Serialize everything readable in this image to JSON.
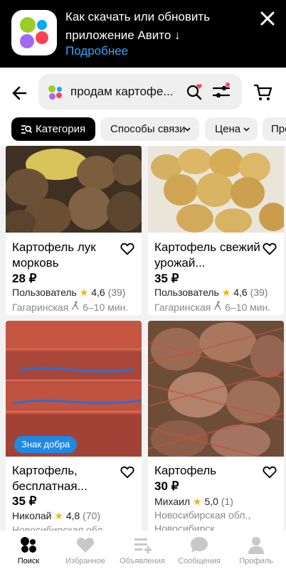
{
  "banner": {
    "title": "Как скачать или обновить приложение Авито ↓",
    "link": "Подробнее"
  },
  "search": {
    "query": "продам картофе..."
  },
  "chips": [
    {
      "label": "Категория"
    },
    {
      "label": "Способы связи"
    },
    {
      "label": "Цена"
    },
    {
      "label": "Про"
    }
  ],
  "listings": [
    {
      "title": "Картофель лук морковь",
      "price": "28 ₽",
      "seller": "Пользователь",
      "rating": "4,6",
      "reviews": "(39)",
      "location": "Гагаринская",
      "eta": "6–10 мин."
    },
    {
      "title": "Картофель свежий урожай...",
      "price": "35 ₽",
      "seller": "Пользователь",
      "rating": "4,6",
      "reviews": "(39)",
      "location": "Гагаринская",
      "eta": "6–10 мин."
    },
    {
      "title": "Картофель, бесплатная...",
      "price": "35 ₽",
      "seller": "Николай",
      "rating": "4,8",
      "reviews": "(70)",
      "location": "Новосибирская обл.",
      "badge": "Знак добра"
    },
    {
      "title": "Картофель",
      "price": "30 ₽",
      "seller": "Михаил",
      "rating": "5,0",
      "reviews": "(1)",
      "location": "Новосибирская обл., Новосибирск"
    }
  ],
  "tabs": [
    {
      "label": "Поиск"
    },
    {
      "label": "Избранное"
    },
    {
      "label": "Объявления"
    },
    {
      "label": "Сообщения"
    },
    {
      "label": "Профиль"
    }
  ],
  "colors": {
    "accent_link": "#2ea8ff",
    "star": "#f5b300",
    "badge": "#1e88e5"
  },
  "icons": [
    "avito-app-icon",
    "close-icon",
    "back-arrow-icon",
    "avito-logo-icon",
    "search-favorite-icon",
    "filters-icon",
    "cart-icon",
    "category-filter-icon",
    "chevron-down-icon",
    "heart-icon",
    "star-icon",
    "walking-icon",
    "search-tab-icon",
    "favorites-tab-icon",
    "listings-tab-icon",
    "messages-tab-icon",
    "profile-tab-icon"
  ]
}
